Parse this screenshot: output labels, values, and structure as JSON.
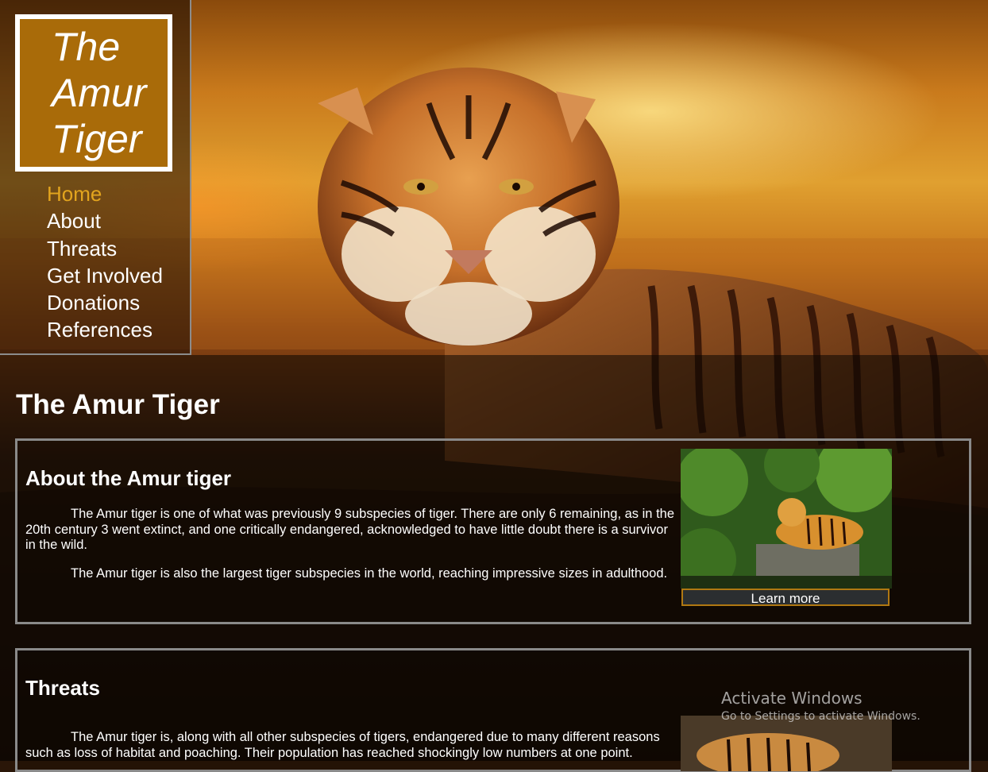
{
  "colors": {
    "accent": "#a96b09",
    "nav_active": "#e2a41e",
    "button_border": "#b07812",
    "card_border": "#8a8a8a"
  },
  "logo": {
    "lines": [
      "The",
      "Amur",
      "Tiger"
    ]
  },
  "nav": {
    "items": [
      {
        "label": "Home",
        "active": true
      },
      {
        "label": "About",
        "active": false
      },
      {
        "label": "Threats",
        "active": false
      },
      {
        "label": "Get Involved",
        "active": false
      },
      {
        "label": "Donations",
        "active": false
      },
      {
        "label": "References",
        "active": false
      }
    ]
  },
  "main": {
    "title": "The Amur Tiger",
    "about": {
      "heading": "About the Amur tiger",
      "paragraphs": [
        "The Amur tiger is one of what was previously 9 subspecies of tiger. There are only 6 remaining, as in the 20th century 3 went extinct, and one critically endangered, acknowledged to have little doubt there is a survivor in the wild.",
        "The Amur tiger is also the largest tiger subspecies in the world, reaching impressive sizes in adulthood."
      ],
      "button_label": "Learn more"
    },
    "threats": {
      "heading": "Threats",
      "paragraphs": [
        "The Amur tiger is, along with all other subspecies of tigers, endangered due to many different reasons such as loss of habitat and poaching. Their population has reached shockingly low numbers at one point."
      ]
    }
  },
  "watermark": {
    "title": "Activate Windows",
    "subtitle": "Go to Settings to activate Windows."
  }
}
